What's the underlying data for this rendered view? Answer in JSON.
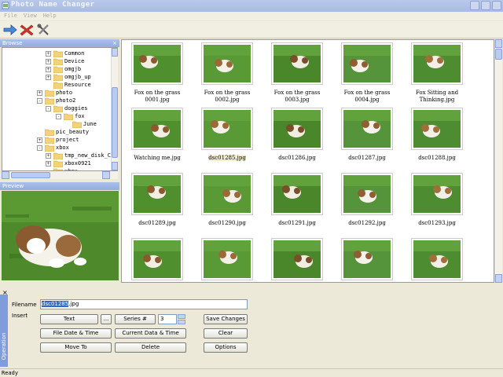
{
  "window": {
    "title": "Photo Name Changer"
  },
  "menu": [
    "File",
    "View",
    "Help"
  ],
  "toolbar": {
    "icons": [
      "forward-arrow-icon",
      "delete-x-icon",
      "tools-icon"
    ]
  },
  "browse": {
    "header": "Browse",
    "tree": [
      {
        "label": "Common",
        "depth": 2,
        "expander": "+"
      },
      {
        "label": "Device",
        "depth": 2,
        "expander": "+"
      },
      {
        "label": "omgjb",
        "depth": 2,
        "expander": "+"
      },
      {
        "label": "omgjb_up",
        "depth": 2,
        "expander": "+"
      },
      {
        "label": "Resource",
        "depth": 2,
        "expander": ""
      },
      {
        "label": "photo",
        "depth": 1,
        "expander": "+"
      },
      {
        "label": "photo2",
        "depth": 1,
        "expander": "-"
      },
      {
        "label": "doggies",
        "depth": 2,
        "expander": "-"
      },
      {
        "label": "fox",
        "depth": 3,
        "expander": "-"
      },
      {
        "label": "June",
        "depth": 4,
        "expander": ""
      },
      {
        "label": "pic_beauty",
        "depth": 1,
        "expander": ""
      },
      {
        "label": "project",
        "depth": 1,
        "expander": "+"
      },
      {
        "label": "xbox",
        "depth": 1,
        "expander": "-"
      },
      {
        "label": "tmp_new_disk_C_fi",
        "depth": 2,
        "expander": "+"
      },
      {
        "label": "xbox0921",
        "depth": 2,
        "expander": "+"
      },
      {
        "label": "xbox",
        "depth": 2,
        "expander": ""
      }
    ]
  },
  "preview": {
    "header": "Preview"
  },
  "photos": [
    "Fox on the grass 0001.jpg",
    "Fox on the grass 0002.jpg",
    "Fox on the grass 0003.jpg",
    "Fox on the grass 0004.jpg",
    "Fox Sitting and Thinking.jpg",
    "Watching me.jpg",
    "dsc01285.jpg",
    "dsc01286.jpg",
    "dsc01287.jpg",
    "dsc01288.jpg",
    "dsc01289.jpg",
    "dsc01290.jpg",
    "dsc01291.jpg",
    "dsc01292.jpg",
    "dsc01293.jpg",
    "",
    "",
    "",
    "",
    ""
  ],
  "selected_photo": "dsc01285.jpg",
  "operation": {
    "sidebar_label": "Operation",
    "filename_label": "Filename",
    "filename_selected": "dsc01285",
    "filename_ext": ".jpg",
    "insert_label": "Insert",
    "buttons": {
      "text": "Text",
      "ellipsis": "...",
      "series": "Series #",
      "series_value": "3",
      "save_changes": "Save Changes",
      "file_date_time": "File Date & Time",
      "current_data_time": "Current Data & Time",
      "clear": "Clear",
      "move_to": "Move To",
      "delete": "Delete",
      "options": "Options"
    },
    "close_glyph": "×"
  },
  "status": {
    "text": "Ready"
  }
}
